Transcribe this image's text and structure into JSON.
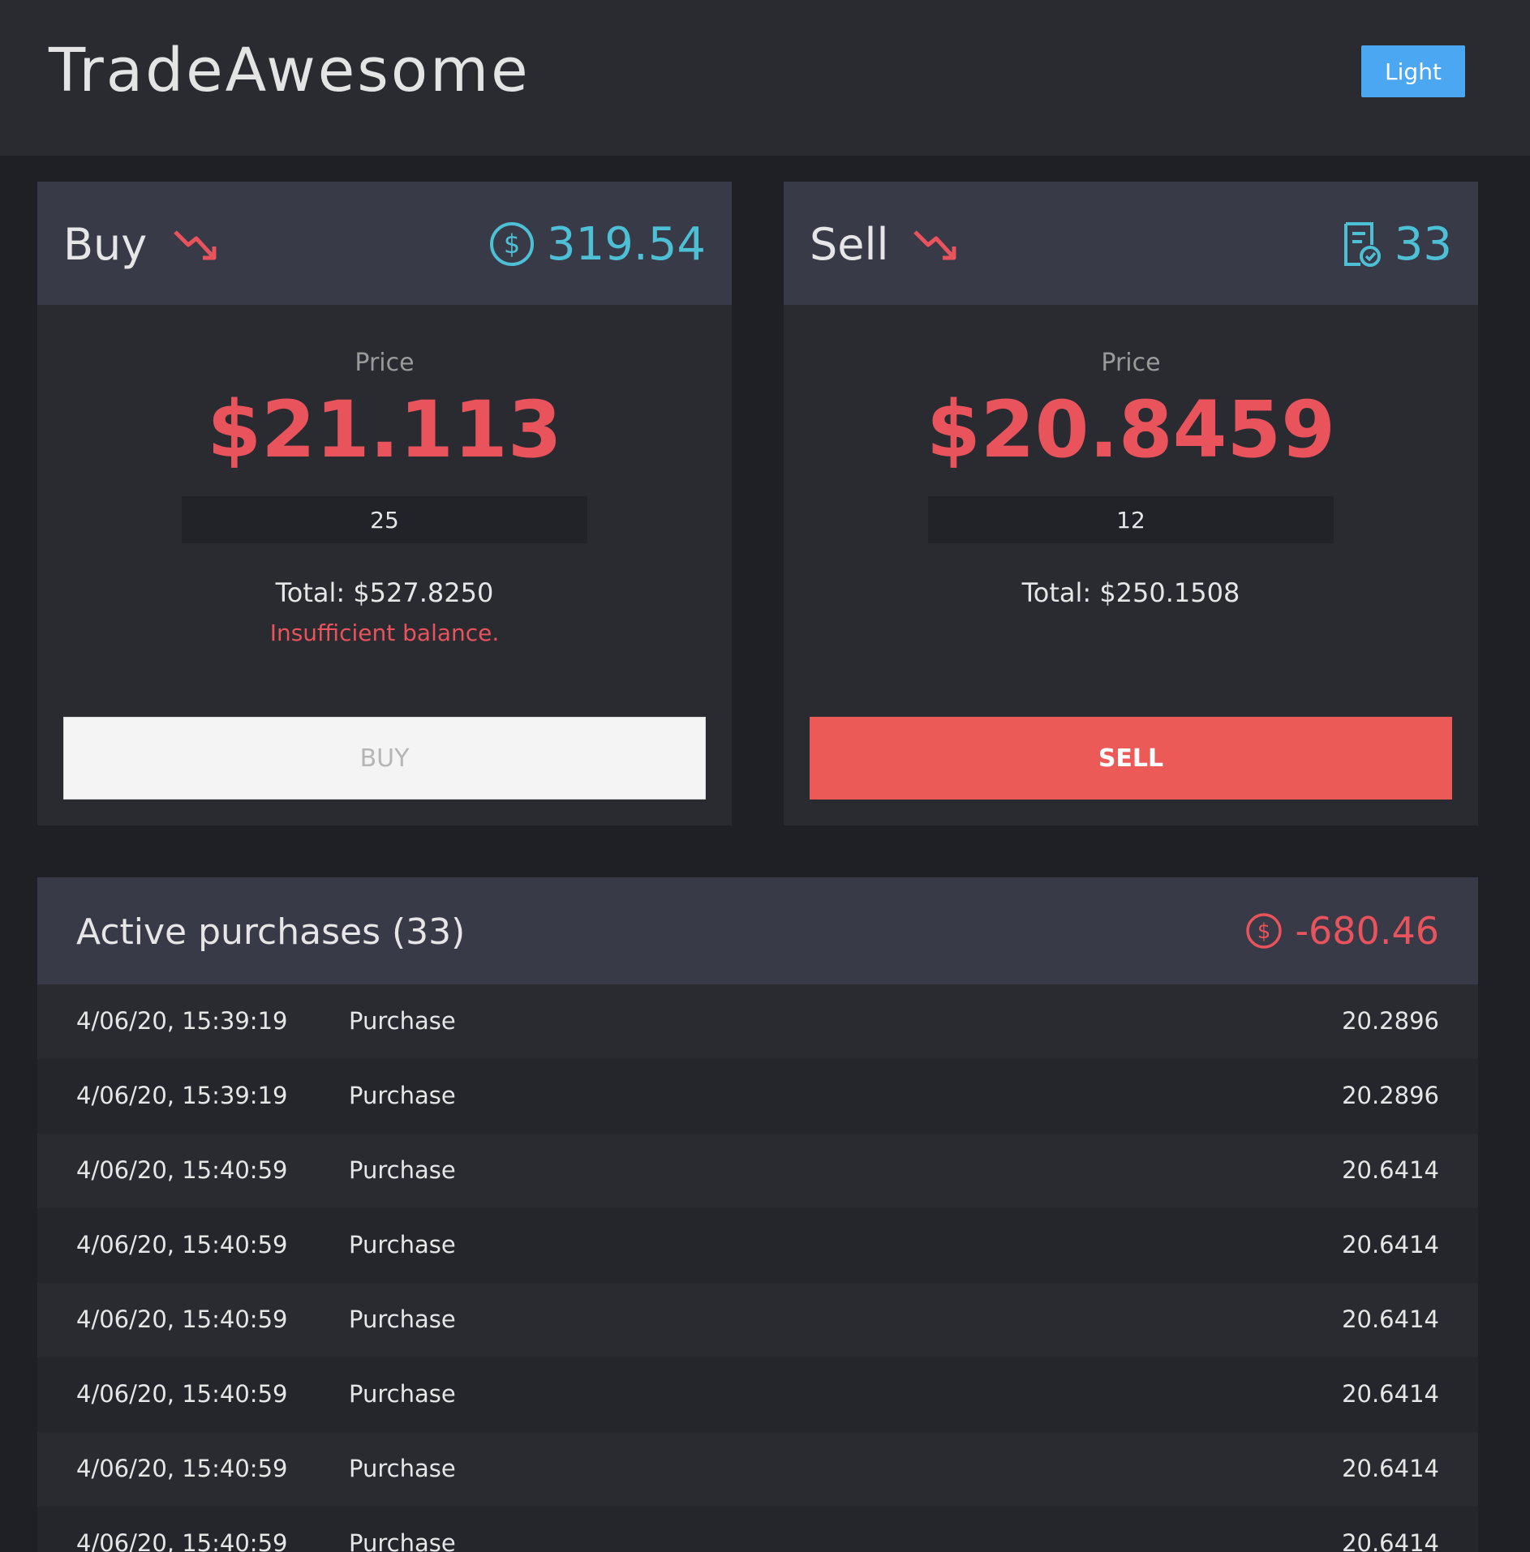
{
  "header": {
    "title": "TradeAwesome",
    "theme_toggle_label": "Light"
  },
  "buy": {
    "title": "Buy",
    "trend_icon": "trending-down-icon",
    "balance_icon": "dollar-circle-icon",
    "balance": "319.54",
    "price_label": "Price",
    "price": "$21.113",
    "quantity": "25",
    "total": "Total: $527.8250",
    "error": "Insufficient balance.",
    "button_label": "BUY"
  },
  "sell": {
    "title": "Sell",
    "trend_icon": "trending-down-icon",
    "holdings_icon": "receipt-check-icon",
    "holdings": "33",
    "price_label": "Price",
    "price": "$20.8459",
    "quantity": "12",
    "total": "Total: $250.1508",
    "button_label": "SELL"
  },
  "purchases": {
    "title": "Active purchases (33)",
    "total_icon": "dollar-circle-icon",
    "total": "-680.46",
    "rows": [
      {
        "date": "4/06/20, 15:39:19",
        "type": "Purchase",
        "value": "20.2896"
      },
      {
        "date": "4/06/20, 15:39:19",
        "type": "Purchase",
        "value": "20.2896"
      },
      {
        "date": "4/06/20, 15:40:59",
        "type": "Purchase",
        "value": "20.6414"
      },
      {
        "date": "4/06/20, 15:40:59",
        "type": "Purchase",
        "value": "20.6414"
      },
      {
        "date": "4/06/20, 15:40:59",
        "type": "Purchase",
        "value": "20.6414"
      },
      {
        "date": "4/06/20, 15:40:59",
        "type": "Purchase",
        "value": "20.6414"
      },
      {
        "date": "4/06/20, 15:40:59",
        "type": "Purchase",
        "value": "20.6414"
      },
      {
        "date": "4/06/20, 15:40:59",
        "type": "Purchase",
        "value": "20.6414"
      }
    ]
  },
  "colors": {
    "background": "#1f2025",
    "panel": "#2a2b31",
    "panel_header": "#383a48",
    "accent_blue": "#4ba7f2",
    "accent_cyan": "#4ec0d6",
    "negative_red": "#e8535c",
    "sell_button": "#ec5a58"
  }
}
